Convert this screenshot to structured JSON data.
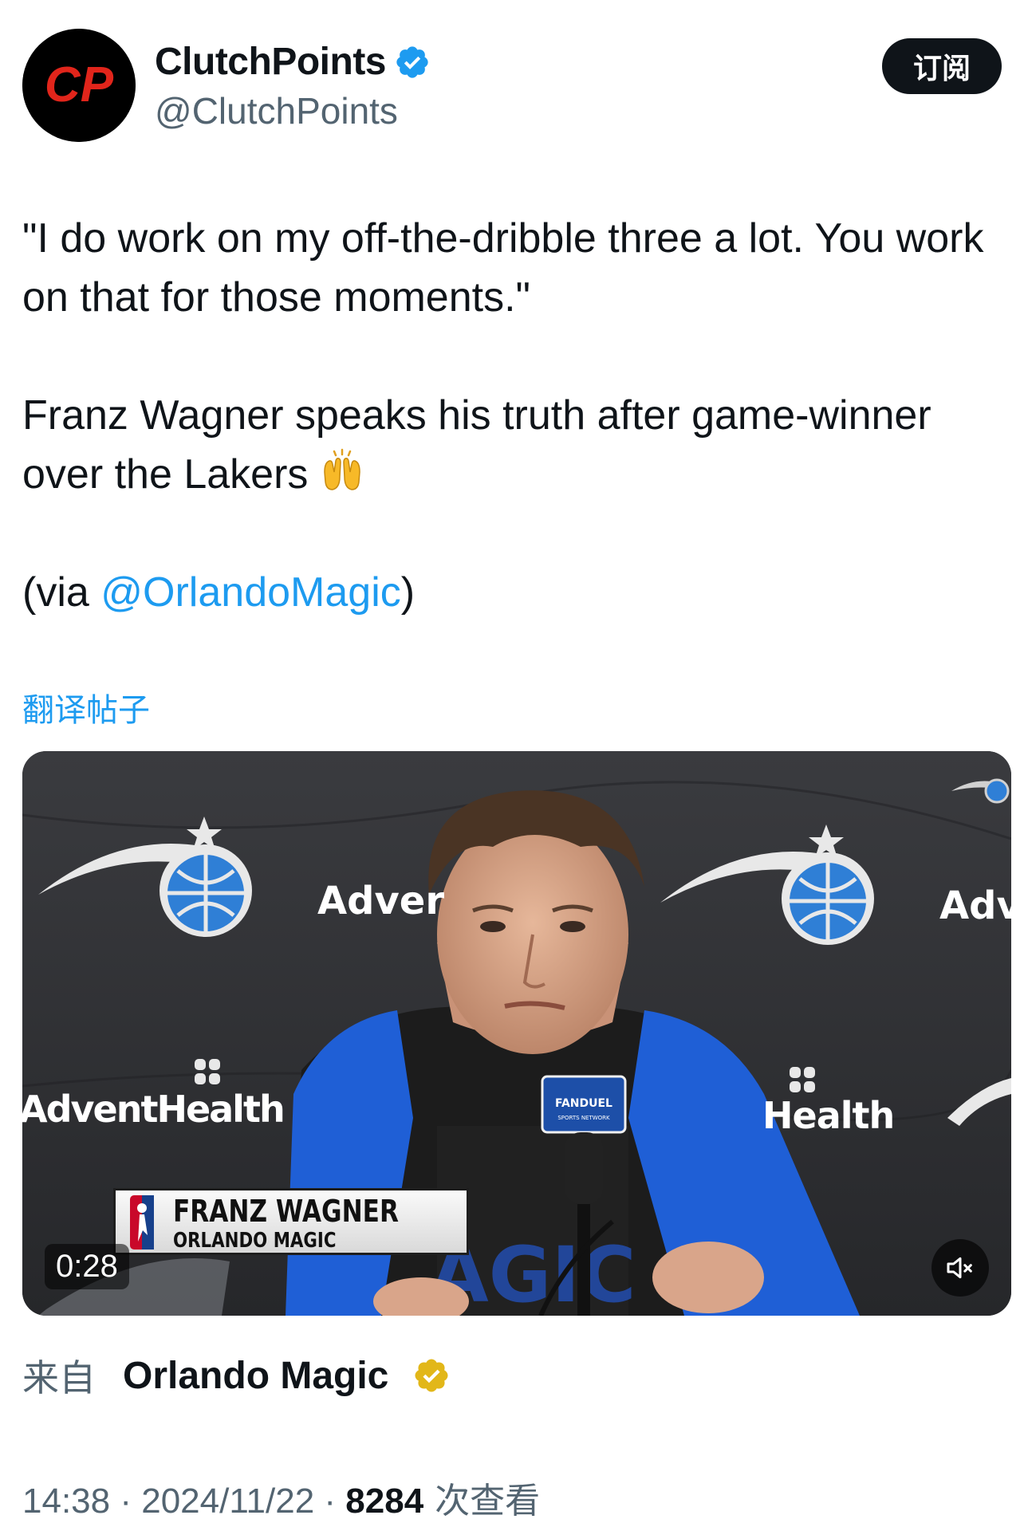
{
  "author": {
    "display_name": "ClutchPoints",
    "handle": "@ClutchPoints",
    "avatar_text": "CP",
    "verified_icon": "blue-verified-badge"
  },
  "subscribe_label": "订阅",
  "tweet": {
    "paragraph1": "\"I do work on my off-the-dribble three a lot. You work on that for those moments.\"",
    "paragraph2": "Franz Wagner speaks his truth after game-winner over the Lakers",
    "paragraph2_emoji": "raising-hands-emoji",
    "via_prefix": "(via ",
    "via_mention": "@OrlandoMagic",
    "via_suffix": ")"
  },
  "translate_label": "翻译帖子",
  "video": {
    "duration": "0:28",
    "lower_third_name": "FRANZ WAGNER",
    "lower_third_team": "ORLANDO MAGIC",
    "backdrop_sponsor": "AdventHealth",
    "backdrop_sponsor_partial_left": "Adver",
    "backdrop_sponsor_partial_right": "Adv",
    "backdrop_sponsor_partial_health": "Health",
    "mic_flag_brand": "FANDUEL",
    "mic_flag_sub": "SPORTS NETWORK",
    "mute_icon": "speaker-muted-icon"
  },
  "source": {
    "prefix": "来自",
    "name": "Orlando Magic",
    "badge_icon": "gold-verified-badge"
  },
  "meta": {
    "time": "14:38",
    "separator": " · ",
    "date": "2024/11/22",
    "views": "8284",
    "views_label": " 次查看"
  },
  "colors": {
    "link": "#1d9bf0",
    "secondary_text": "#536471",
    "primary_text": "#0f1419",
    "magic_blue": "#0077c0",
    "gold": "#e2b719"
  }
}
